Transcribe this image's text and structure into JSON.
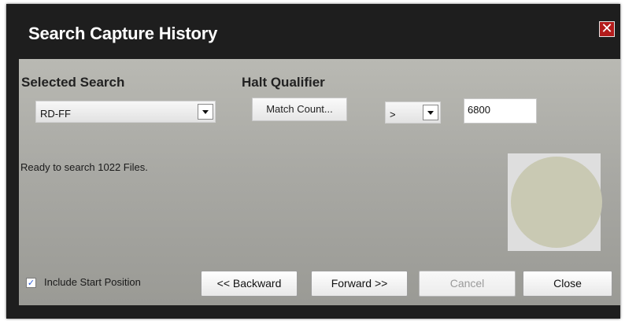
{
  "dialog": {
    "title": "Search Capture History",
    "close_glyph": "✕"
  },
  "selected_search": {
    "heading": "Selected Search",
    "value": "RD-FF"
  },
  "halt_qualifier": {
    "heading": "Halt Qualifier",
    "field_label": "Match Count...",
    "operator": ">",
    "threshold": "6800"
  },
  "status_text": "Ready to search 1022 Files.",
  "include_start_position": {
    "label": "Include Start Position",
    "checked": true,
    "check_glyph": "✓"
  },
  "buttons": {
    "backward": "<< Backward",
    "forward": "Forward >>",
    "cancel": "Cancel",
    "close": "Close"
  },
  "colors": {
    "title_bar": "#1e1e1e",
    "close_button": "#b31c1c",
    "indicator_circle": "#c9c9b3",
    "checkbox_mark": "#2a5bd7"
  },
  "icons": {
    "close": "close-icon",
    "dropdown": "chevron-down-icon",
    "check": "checkmark-icon"
  }
}
